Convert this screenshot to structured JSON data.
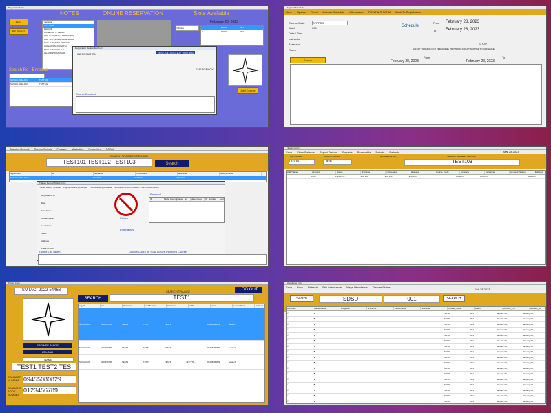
{
  "p1": {
    "title": "RegistrationForm",
    "notes_label": "NOTES",
    "online_label": "ONLINE RESERVATION",
    "slots_label": "Slots Available",
    "add_btn": "ADD",
    "print_btn": "RE PRINT",
    "search_label": "Search Re - Enrolled",
    "date": "February 28, 2023",
    "sdsd": "SDSD",
    "emergency": "EMERGENCY",
    "course_enrolled": "Course Enrolled",
    "dialog_title": "Registration Re-Enrolled Form",
    "info_tab": "INFORMATION",
    "name_field": "TEST101 TEST102 TEST103",
    "add_course_btn": "Add Course",
    "list_items": [
      "message",
      "COTTAGE",
      "DELUXE",
      "DUNE PARTY RECEP",
      "FOR ALLS (SMALLER ROOMS)",
      "FOR SLOTS AVAILABLE SPACE",
      "FULL CATERING SERVICE",
      "HALL/ROOM (PRIVATE)",
      "NEW FUNCTION HALL",
      "INLAND PROMENADE"
    ],
    "slots_rows": [
      [
        "1",
        "SDSD",
        "001"
      ],
      [
        "2",
        "SDSD",
        "002"
      ]
    ],
    "reg_rows": [
      [
        "SMTACI-2022-001",
        "TEST101"
      ],
      [
        "SMTACI-2022-002",
        "TEST102"
      ]
    ]
  },
  "p2": {
    "title": "Regional Schedule",
    "toolbar": [
      "Save",
      "Update",
      "Reset",
      "Activate Schedule",
      "Attendance",
      "PRINT & R FORM",
      "Back To Registration"
    ],
    "course_code_label": "Course Code",
    "course_code_value": "STPPDS",
    "batch_label": "Batch",
    "batch_value": "009",
    "date_time_label": "Date / Time",
    "instructor_label": "Instructor",
    "assessor_label": "Assessor",
    "room_label": "Room",
    "schedule_label": "Schedule",
    "from_label": "From",
    "to_label": "To",
    "from_date": "February  28, 2023",
    "to_date": "February  28, 2023",
    "course_name": "STCW",
    "course_desc": "SAFETY TRAINING FOR PERSONNEL PROVIDING DIRECT SERVICE TO PASSENGE",
    "search_btn": "Search",
    "from2": "From",
    "to2": "To",
    "from_date2": "February  28, 2023",
    "to_date2": "February  28, 2023"
  },
  "p3": {
    "menu": [
      "Training Record",
      "Course Details",
      "Finance",
      "Marketing",
      "Properties",
      "SCAN"
    ],
    "header": "SEARCH TRAINEES RECORD",
    "name": "TEST101  TEST102  TEST103",
    "search_btn": "Search",
    "cols": [
      "registration",
      "id",
      "firstname",
      "middlename",
      "lastname",
      "date_enrolled"
    ],
    "row": [
      "SMTACI-2022-0027",
      "...",
      "TEST101",
      "TEST102",
      "TEST103",
      "..."
    ],
    "dialog_title": "Trainee Record To Edit Form",
    "tabs": [
      "Trainee History Changes",
      "Payment History Changes",
      "Picture History Activation",
      "Schedule History Activation",
      "Re-print Admission"
    ],
    "picture_label": "Picture",
    "payment_label": "Payment",
    "emergency": "Emergency",
    "taken_label": "Trainee List Taken",
    "double_click": "Double Click The Row To See Payment Course",
    "fields": [
      "Registration ID",
      "Date",
      "First Name",
      "Middle Name",
      "Last Name",
      "Suffix",
      "Address",
      "Place Of Birth"
    ],
    "payment_cols": [
      "ID",
      "Mode_Payment",
      "payed_on",
      "date_payed",
      "Or_Number",
      "...ent"
    ]
  },
  "p4": {
    "title": "Finance Form",
    "toolbar": [
      "Save",
      "Show Balance",
      "Report Trainee",
      "Payable",
      "Receivable",
      "Rebate",
      "Refresh"
    ],
    "date": "Mar 28 2023",
    "header_labels": [
      "OR NUMBER",
      "Mode of Payment",
      "REFERENCE NO.",
      "SEARCH TRAINEES RECORD"
    ],
    "or_value": "00008",
    "mode_value": "Cash",
    "name": "TEST103",
    "cols": [
      "Add Trainee",
      "payment",
      "Status",
      "firstname",
      "middlename",
      "lastname",
      "Course_Code",
      "company",
      "marketing",
      "payment_Status",
      "Enlisted"
    ],
    "row": [
      "",
      "1000",
      "Partial Pa...",
      "TEST101",
      "TEST102",
      "TEST103",
      "",
      "WALKIN",
      "WALKIN",
      "",
      "seatech"
    ]
  },
  "p5": {
    "title": "Picture Form",
    "reg_no": "SMTACI-2022-54463",
    "logout_btn": "LOG OUT",
    "search_btn": "SEARCH",
    "search_header": "SEARCH TRAINEE",
    "search_value": "TEST1",
    "browse_btn": "BROWSE IMAGE",
    "upload_btn": "UPLOAD",
    "name_label": "NAME",
    "name_value": "TEST1 TEST2 TES",
    "contact_label": "CONTACT NUMBER",
    "contact_value": "09455080829",
    "seaman_label": "SEAMANS BOOK NUMBER",
    "seaman_value": "0123456789",
    "picture_label": "Picture",
    "cols": [
      "reg_id",
      "srn",
      "firstname",
      "middlename",
      "lastname",
      "suffix",
      "cont",
      "seamanbook",
      "Enlisted"
    ],
    "rows": [
      [
        "SMTACI-20..",
        "0123456789",
        "TEST1",
        "TEST2",
        "TEST3",
        "",
        "09455080829",
        "seatech"
      ],
      [
        "SMTACI-20..",
        "0123456789",
        "TEST1",
        "TEST2",
        "TEST3",
        "",
        "09455080829",
        "seatech"
      ],
      [
        "SMTACI-20..",
        "0123456789",
        "TEST1",
        "TEST2",
        "TEST3",
        "4237 (78...",
        "09455080829",
        "seatech"
      ]
    ]
  },
  "p6": {
    "title": "Attendance Form",
    "toolbar": [
      "Save",
      "Back",
      "Refresh",
      "Site Attendance",
      "Naga Attendance",
      "Trainee Status"
    ],
    "date": "Feb 28 2023",
    "search_btn": "Search",
    "course": "SDSD",
    "batch": "001",
    "search_btn2": "SEARCH",
    "cols": [
      "checkbox",
      "traineestatus",
      "imagesec",
      "firstname",
      "middlename",
      "lastname",
      "Course_Code",
      "Batch",
      "Schedule_Fro",
      "Schedule_To"
    ],
    "row_course": "SDSD",
    "row_batch": "001",
    "row_date": "January 03,",
    "row_count": 17
  }
}
